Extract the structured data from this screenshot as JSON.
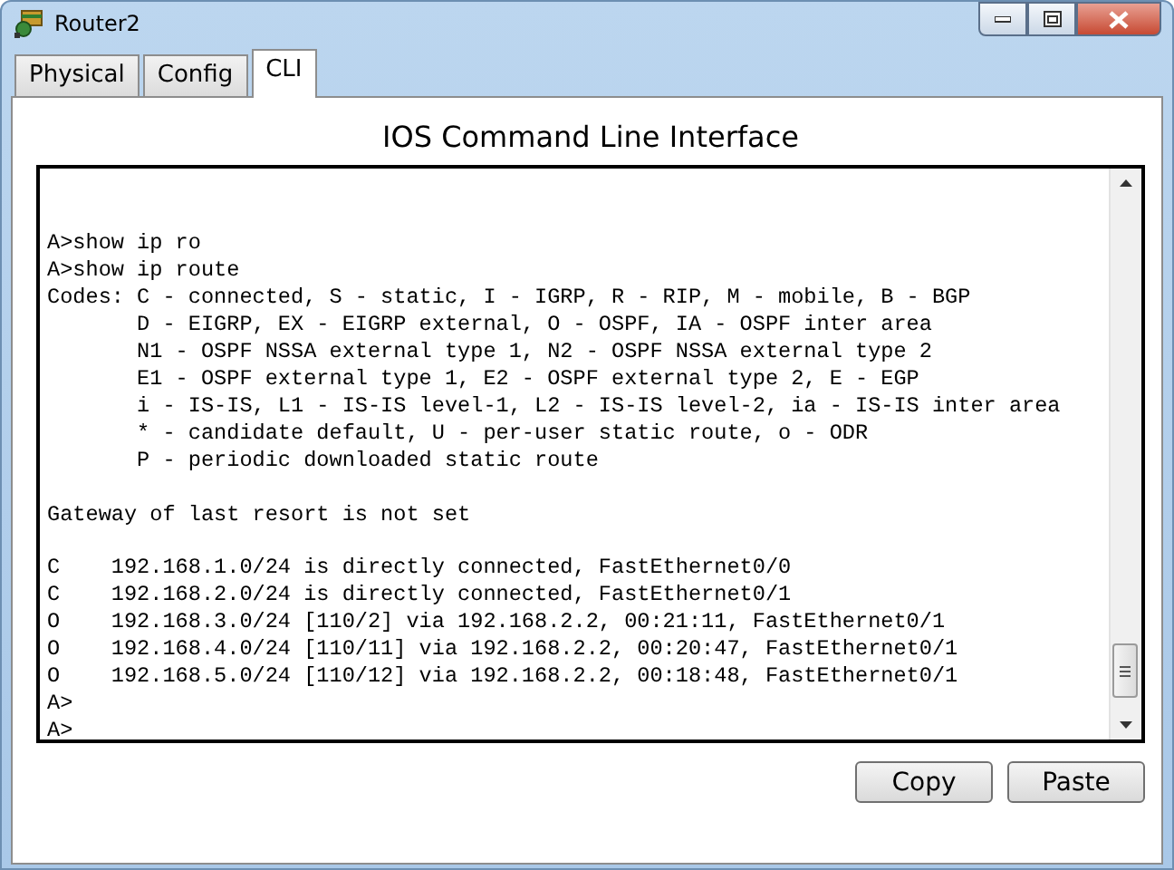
{
  "window": {
    "title": "Router2"
  },
  "tabs": [
    {
      "label": "Physical",
      "selected": false
    },
    {
      "label": "Config",
      "selected": false
    },
    {
      "label": "CLI",
      "selected": true
    }
  ],
  "heading": "IOS Command Line Interface",
  "terminal": {
    "blocks": [
      [
        "A>show ip ro",
        "A>show ip route",
        "Codes: C - connected, S - static, I - IGRP, R - RIP, M - mobile, B - BGP",
        "       D - EIGRP, EX - EIGRP external, O - OSPF, IA - OSPF inter area",
        "       N1 - OSPF NSSA external type 1, N2 - OSPF NSSA external type 2",
        "       E1 - OSPF external type 1, E2 - OSPF external type 2, E - EGP",
        "       i - IS-IS, L1 - IS-IS level-1, L2 - IS-IS level-2, ia - IS-IS inter area",
        "       * - candidate default, U - per-user static route, o - ODR",
        "       P - periodic downloaded static route"
      ],
      [
        "Gateway of last resort is not set"
      ],
      [
        "C    192.168.1.0/24 is directly connected, FastEthernet0/0",
        "C    192.168.2.0/24 is directly connected, FastEthernet0/1",
        "O    192.168.3.0/24 [110/2] via 192.168.2.2, 00:21:11, FastEthernet0/1",
        "O    192.168.4.0/24 [110/11] via 192.168.2.2, 00:20:47, FastEthernet0/1",
        "O    192.168.5.0/24 [110/12] via 192.168.2.2, 00:18:48, FastEthernet0/1",
        "A>",
        "A>"
      ]
    ]
  },
  "buttons": [
    "Copy",
    "Paste"
  ]
}
